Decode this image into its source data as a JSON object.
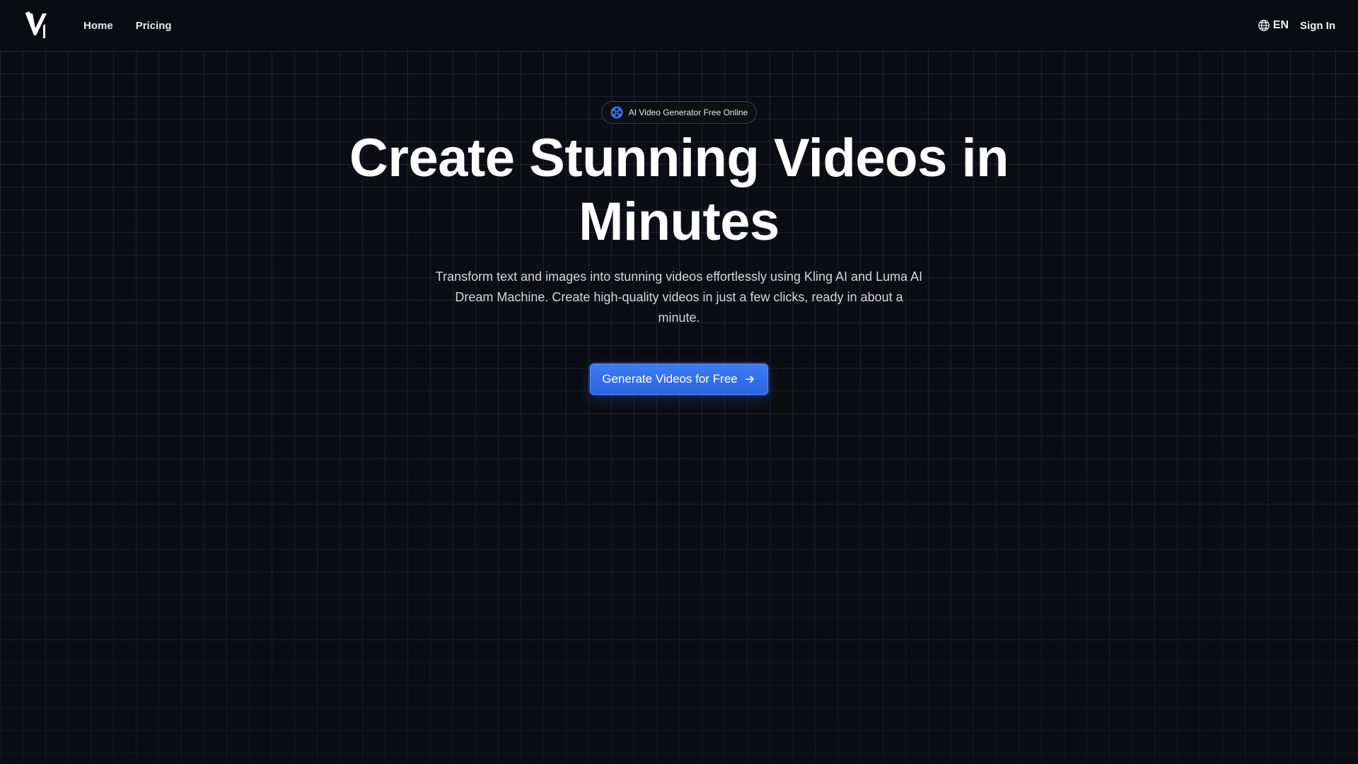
{
  "header": {
    "logo_alt": "V1",
    "nav": [
      {
        "label": "Home"
      },
      {
        "label": "Pricing"
      }
    ],
    "language": "EN",
    "sign_in": "Sign In"
  },
  "hero": {
    "badge": "AI Video Generator Free Online",
    "headline_line1": "Create Stunning Videos in",
    "headline_line2": "Minutes",
    "subtitle": "Transform text and images into stunning videos effortlessly using Kling AI and Luma AI Dream Machine. Create high-quality videos in just a few clicks, ready in about a minute.",
    "cta_label": "Generate Videos for Free"
  },
  "colors": {
    "background": "#0c0d12",
    "grid_line": "#46549a",
    "accent": "#2f6ce8",
    "text": "#ffffff",
    "muted_text": "#d3d5de"
  },
  "icons": {
    "logo": "v1-logo-icon",
    "language": "globe-icon",
    "badge": "film-reel-icon",
    "cta": "arrow-right-icon"
  }
}
